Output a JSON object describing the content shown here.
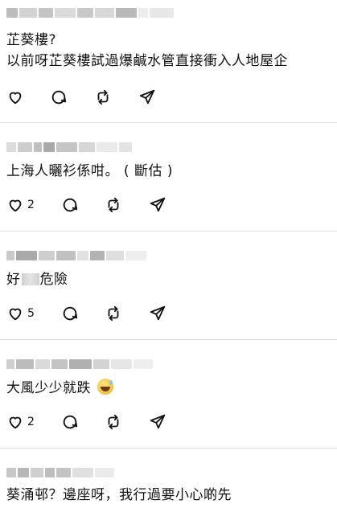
{
  "posts": [
    {
      "text_lines": [
        "芷葵樓?",
        "以前呀芷葵樓試過爆鹹水管直接衝入人地屋企"
      ],
      "likes": ""
    },
    {
      "text_lines": [
        "上海人曬衫係咁。 ( 斷估 )"
      ],
      "likes": "2"
    },
    {
      "text_before": "好",
      "text_after": "危險",
      "likes": "5"
    },
    {
      "text_lines": [
        "大風少少就跌"
      ],
      "emoji": "sweat-smile-emoji",
      "likes": "2"
    },
    {
      "text_lines": [
        "葵涌邨？邊座呀，我行過要小心啲先"
      ]
    }
  ],
  "icons": {
    "like": "heart-icon",
    "reply": "comment-icon",
    "repost": "repost-icon",
    "share": "send-icon"
  }
}
